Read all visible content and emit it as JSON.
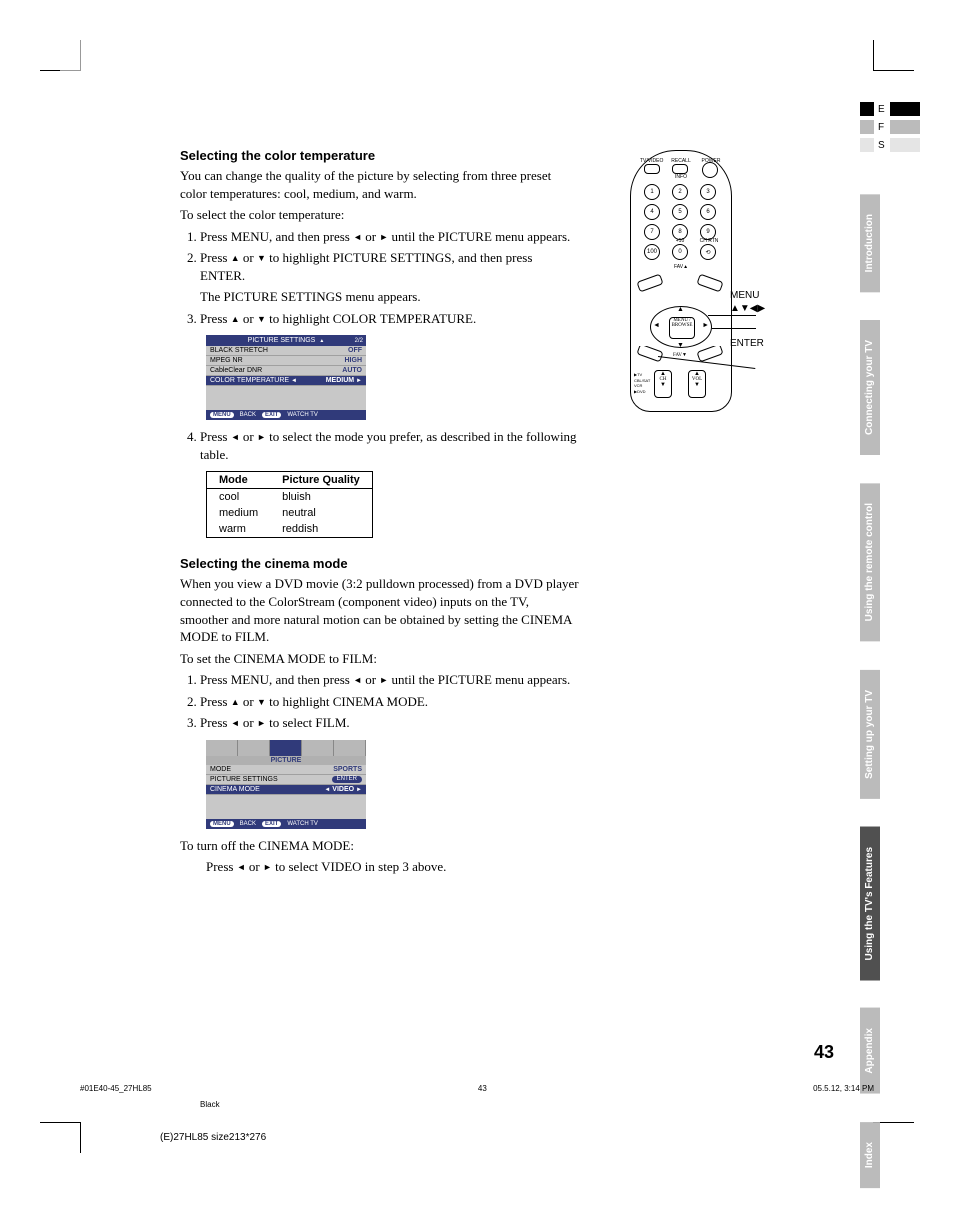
{
  "lang": {
    "a": "E",
    "b": "F",
    "c": "S"
  },
  "tabs": {
    "t1": "Introduction",
    "t2": "Connecting your TV",
    "t3": "Using the remote control",
    "t4": "Setting up your TV",
    "t5": "Using the TV's Features",
    "t6": "Appendix",
    "t7": "Index"
  },
  "h_color": "Selecting the color temperature",
  "p_color1": "You can change the quality of the picture by selecting from three preset color temperatures: cool, medium, and warm.",
  "p_color2": "To select the color temperature:",
  "step_c1a": "Press MENU, and then press ",
  "step_c1b": " or ",
  "step_c1c": " until the PICTURE menu appears.",
  "step_c2a": "Press ",
  "step_c2b": " or ",
  "step_c2c": " to highlight PICTURE SETTINGS, and then press ENTER.",
  "step_c2d": "The PICTURE SETTINGS menu appears.",
  "step_c3a": "Press ",
  "step_c3b": " or ",
  "step_c3c": " to highlight COLOR TEMPERATURE.",
  "osd1": {
    "title": "PICTURE SETTINGS",
    "page": "2/2",
    "rows": [
      {
        "label": "BLACK STRETCH",
        "value": "OFF"
      },
      {
        "label": "MPEG NR",
        "value": "HIGH"
      },
      {
        "label": "CableClear DNR",
        "value": "AUTO"
      },
      {
        "label": "COLOR TEMPERATURE",
        "value": "MEDIUM"
      }
    ],
    "footer": {
      "menu": "MENU",
      "back": "BACK",
      "exit": "EXIT",
      "watch": "WATCH TV"
    }
  },
  "step_c4a": "Press ",
  "step_c4b": " or ",
  "step_c4c": " to select the mode you prefer, as described in the following table.",
  "table": {
    "h1": "Mode",
    "h2": "Picture Quality",
    "rows": [
      {
        "mode": "cool",
        "pq": "bluish"
      },
      {
        "mode": "medium",
        "pq": "neutral"
      },
      {
        "mode": "warm",
        "pq": "reddish"
      }
    ]
  },
  "h_cinema": "Selecting the cinema mode",
  "p_cinema1": "When you view a DVD movie (3:2 pulldown processed) from a DVD player connected to the ColorStream (component video) inputs on the TV, smoother and more natural motion can be obtained by setting the CINEMA MODE to FILM.",
  "p_cinema2": "To set the CINEMA MODE to FILM:",
  "step_m1a": "Press MENU, and then press ",
  "step_m1b": " or ",
  "step_m1c": " until the PICTURE menu appears.",
  "step_m2a": "Press ",
  "step_m2b": " or ",
  "step_m2c": " to highlight CINEMA MODE.",
  "step_m3a": "Press ",
  "step_m3b": " or ",
  "step_m3c": " to select FILM.",
  "osd2": {
    "title": "PICTURE",
    "rows": [
      {
        "label": "MODE",
        "value": "SPORTS"
      },
      {
        "label": "PICTURE SETTINGS",
        "value": "ENTER"
      },
      {
        "label": "CINEMA MODE",
        "value": "VIDEO"
      }
    ],
    "footer": {
      "menu": "MENU",
      "back": "BACK",
      "exit": "EXIT",
      "watch": "WATCH TV"
    }
  },
  "p_off": "To turn off the CINEMA MODE:",
  "p_off2a": "Press ",
  "p_off2b": " or ",
  "p_off2c": " to select VIDEO in step 3 above.",
  "remote": {
    "tvvideo": "TV/VIDEO",
    "recall": "RECALL",
    "power": "POWER",
    "info": "INFO",
    "plus10": "+10",
    "chrtn": "CH RTN",
    "fav": "FAV",
    "menu_label": "MENU",
    "arrows_label": "▲▼◀▶",
    "enter_label": "ENTER",
    "menu_btn": "MENU / BROWSE",
    "ch": "CH",
    "vol": "VOL",
    "tv": "TV",
    "cblsat": "CBL/SAT",
    "vcr": "VCR",
    "dvd": "DVD"
  },
  "page_num": "43",
  "footer": {
    "left": "#01E40-45_27HL85",
    "center": "43",
    "right": "05.5.12, 3:14 PM",
    "black": "Black",
    "doc": "(E)27HL85 size213*276"
  }
}
